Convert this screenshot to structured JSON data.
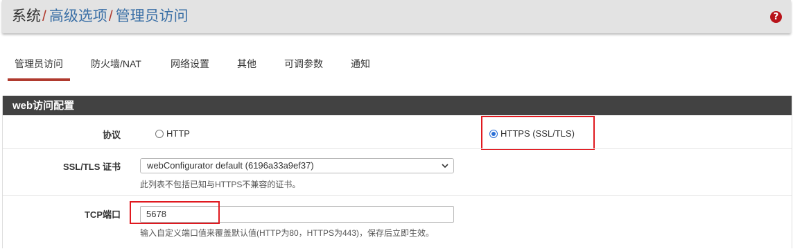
{
  "header": {
    "breadcrumb": [
      {
        "label": "系统",
        "type": "root"
      },
      {
        "label": "高级选项",
        "type": "link"
      },
      {
        "label": "管理员访问",
        "type": "link"
      }
    ],
    "separator": "/",
    "help_icon": "question-circle-icon",
    "help_glyph": "?"
  },
  "tabs": [
    {
      "label": "管理员访问",
      "active": true
    },
    {
      "label": "防火墙/NAT",
      "active": false
    },
    {
      "label": "网络设置",
      "active": false
    },
    {
      "label": "其他",
      "active": false
    },
    {
      "label": "可调参数",
      "active": false
    },
    {
      "label": "通知",
      "active": false
    }
  ],
  "panel": {
    "title": "web访问配置",
    "protocol": {
      "label": "协议",
      "options": [
        {
          "label": "HTTP",
          "checked": false
        },
        {
          "label": "HTTPS (SSL/TLS)",
          "checked": true
        }
      ]
    },
    "ssl_cert": {
      "label": "SSL/TLS 证书",
      "selected": "webConfigurator default (6196a33a9ef37)",
      "help": "此列表不包括已知与HTTPS不兼容的证书。"
    },
    "tcp_port": {
      "label": "TCP端口",
      "value": "5678",
      "help": "输入自定义端口值来覆盖默认值(HTTP为80，HTTPS为443)，保存后立即生效。"
    }
  },
  "colors": {
    "header_bg": "#e3e3e3",
    "accent": "#b03a2e",
    "link": "#3a6fa6",
    "panel_heading_bg": "#424242",
    "highlight_border": "#e0191f",
    "radio_checked": "#2b6fd6"
  }
}
